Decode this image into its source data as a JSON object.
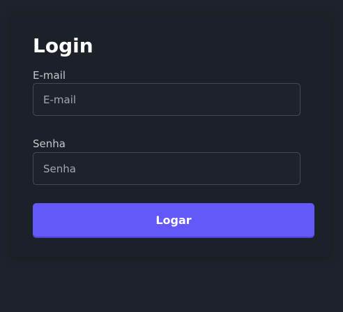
{
  "login": {
    "title": "Login",
    "email_label": "E-mail",
    "email_placeholder": "E-mail",
    "email_value": "",
    "password_label": "Senha",
    "password_placeholder": "Senha",
    "password_value": "",
    "submit_label": "Logar"
  },
  "colors": {
    "background": "#1e232b",
    "card": "#1c2129",
    "accent": "#6359fa",
    "input_border": "#454b55"
  }
}
